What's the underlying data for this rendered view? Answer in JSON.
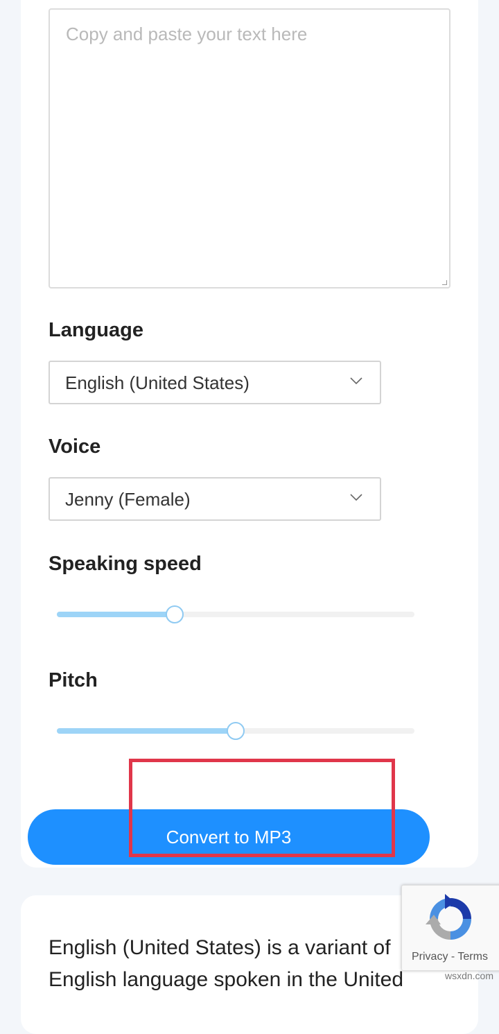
{
  "textarea": {
    "placeholder": "Copy and paste your text here"
  },
  "language": {
    "label": "Language",
    "selected": "English (United States)"
  },
  "voice": {
    "label": "Voice",
    "selected": "Jenny (Female)"
  },
  "speaking_speed": {
    "label": "Speaking speed",
    "value_fraction": 0.33
  },
  "pitch": {
    "label": "Pitch",
    "value_fraction": 0.5
  },
  "convert_button": {
    "label": "Convert to MP3"
  },
  "description": {
    "text": "English (United States) is a variant of English language spoken in the United"
  },
  "recaptcha": {
    "privacy": "Privacy",
    "separator": "-",
    "terms": "Terms"
  },
  "watermark": "wsxdn.com",
  "colors": {
    "accent": "#1e90ff",
    "slider_fill": "#9dd4f7",
    "highlight": "#e0364a"
  }
}
